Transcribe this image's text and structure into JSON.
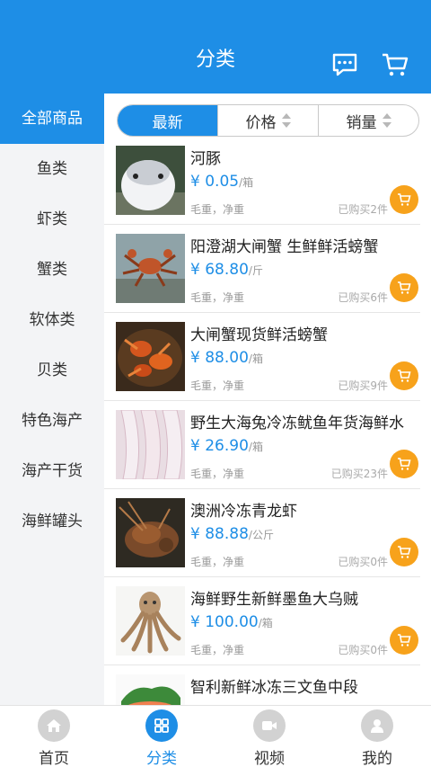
{
  "header": {
    "title": "分类"
  },
  "sidebar": {
    "items": [
      {
        "label": "全部商品"
      },
      {
        "label": "鱼类"
      },
      {
        "label": "虾类"
      },
      {
        "label": "蟹类"
      },
      {
        "label": "软体类"
      },
      {
        "label": "贝类"
      },
      {
        "label": "特色海产"
      },
      {
        "label": "海产干货"
      },
      {
        "label": "海鲜罐头"
      }
    ]
  },
  "sort": {
    "newest": "最新",
    "price": "价格",
    "sales": "销量"
  },
  "products": [
    {
      "name": "河豚",
      "currency": "¥",
      "price": "0.05",
      "unit": "/箱",
      "attrs": "毛重，净重",
      "bought": "已购买2件"
    },
    {
      "name": "阳澄湖大闸蟹 生鲜鲜活螃蟹",
      "currency": "¥",
      "price": "68.80",
      "unit": "/斤",
      "attrs": "毛重，净重",
      "bought": "已购买6件"
    },
    {
      "name": "大闸蟹现货鲜活螃蟹",
      "currency": "¥",
      "price": "88.00",
      "unit": "/箱",
      "attrs": "毛重，净重",
      "bought": "已购买9件"
    },
    {
      "name": "野生大海兔冷冻鱿鱼年货海鲜水",
      "currency": "¥",
      "price": "26.90",
      "unit": "/箱",
      "attrs": "毛重，净重",
      "bought": "已购买23件"
    },
    {
      "name": "澳洲冷冻青龙虾",
      "currency": "¥",
      "price": "88.88",
      "unit": "/公斤",
      "attrs": "毛重，净重",
      "bought": "已购买0件"
    },
    {
      "name": "海鲜野生新鲜墨鱼大乌贼",
      "currency": "¥",
      "price": "100.00",
      "unit": "/箱",
      "attrs": "毛重，净重",
      "bought": "已购买0件"
    },
    {
      "name": "智利新鲜冰冻三文鱼中段"
    }
  ],
  "tabbar": {
    "home": "首页",
    "category": "分类",
    "video": "视频",
    "mine": "我的"
  },
  "colors": {
    "accent": "#1e8ee6",
    "cart": "#f7a21b"
  }
}
